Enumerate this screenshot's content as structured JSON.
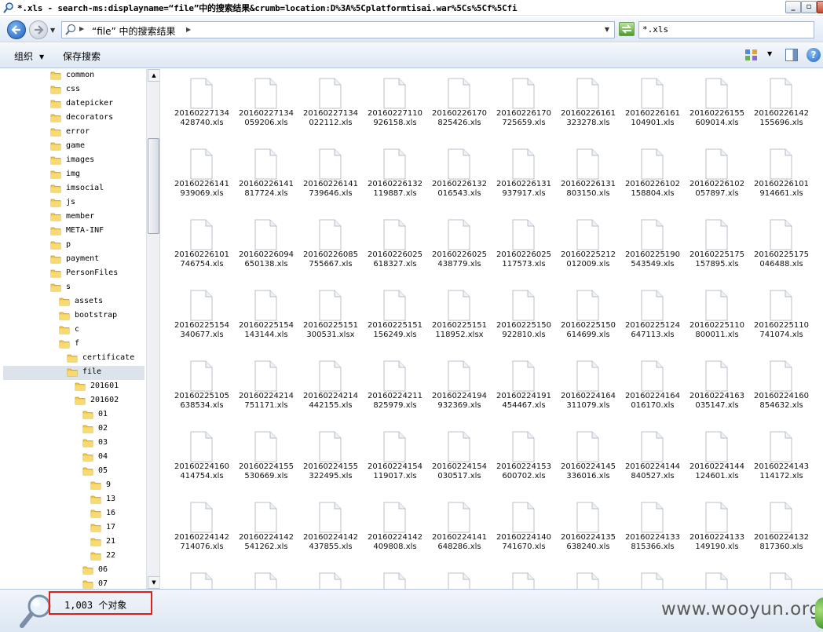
{
  "window": {
    "title": "*.xls - search-ms:displayname=“file”中的搜索结果&crumb=location:D%3A%5Cplatformtisai.war%5Cs%5Cf%5Cfi"
  },
  "address": {
    "breadcrumb": "“file” 中的搜索结果",
    "search_value": "*.xls"
  },
  "toolbar": {
    "organize_label": "组织",
    "save_search_label": "保存搜索",
    "help_label": "?"
  },
  "icons": {
    "back": "back-arrow-icon",
    "forward": "forward-arrow-icon",
    "search": "magnifier-icon",
    "refresh": "refresh-icon",
    "folder": "folder-icon",
    "file": "document-icon",
    "views": "view-grid-icon",
    "preview": "preview-pane-icon"
  },
  "colors": {
    "folder_yellow": "#f1c84b",
    "highlight_red": "#e0201b",
    "selection_gray": "#dde3ea"
  },
  "tree": [
    {
      "label": "common",
      "level": 0
    },
    {
      "label": "css",
      "level": 0
    },
    {
      "label": "datepicker",
      "level": 0
    },
    {
      "label": "decorators",
      "level": 0
    },
    {
      "label": "error",
      "level": 0
    },
    {
      "label": "game",
      "level": 0
    },
    {
      "label": "images",
      "level": 0
    },
    {
      "label": "img",
      "level": 0
    },
    {
      "label": "imsocial",
      "level": 0
    },
    {
      "label": "js",
      "level": 0
    },
    {
      "label": "member",
      "level": 0
    },
    {
      "label": "META-INF",
      "level": 0
    },
    {
      "label": "p",
      "level": 0
    },
    {
      "label": "payment",
      "level": 0
    },
    {
      "label": "PersonFiles",
      "level": 0
    },
    {
      "label": "s",
      "level": 0
    },
    {
      "label": "assets",
      "level": 1
    },
    {
      "label": "bootstrap",
      "level": 1
    },
    {
      "label": "c",
      "level": 1
    },
    {
      "label": "f",
      "level": 1
    },
    {
      "label": "certificate",
      "level": 2
    },
    {
      "label": "file",
      "level": 2,
      "selected": true
    },
    {
      "label": "201601",
      "level": 3
    },
    {
      "label": "201602",
      "level": 3
    },
    {
      "label": "01",
      "level": 4
    },
    {
      "label": "02",
      "level": 4
    },
    {
      "label": "03",
      "level": 4
    },
    {
      "label": "04",
      "level": 4
    },
    {
      "label": "05",
      "level": 4
    },
    {
      "label": "9",
      "level": 5
    },
    {
      "label": "13",
      "level": 5
    },
    {
      "label": "16",
      "level": 5
    },
    {
      "label": "17",
      "level": 5
    },
    {
      "label": "21",
      "level": 5
    },
    {
      "label": "22",
      "level": 5
    },
    {
      "label": "06",
      "level": 4
    },
    {
      "label": "07",
      "level": 4
    }
  ],
  "files": [
    "20160227134428740.xls",
    "20160227134059206.xls",
    "20160227134022112.xls",
    "20160227110926158.xls",
    "20160226170825426.xls",
    "20160226170725659.xls",
    "20160226161323278.xls",
    "20160226161104901.xls",
    "20160226155609014.xls",
    "20160226142155696.xls",
    "20160226141939069.xls",
    "20160226141817724.xls",
    "20160226141739646.xls",
    "20160226132119887.xls",
    "20160226132016543.xls",
    "20160226131937917.xls",
    "20160226131803150.xls",
    "20160226102158804.xls",
    "20160226102057897.xls",
    "20160226101914661.xls",
    "20160226101746754.xls",
    "20160226094650138.xls",
    "20160226085755667.xls",
    "20160226025618327.xls",
    "20160226025438779.xls",
    "20160226025117573.xls",
    "20160225212012009.xls",
    "20160225190543549.xls",
    "20160225175157895.xls",
    "20160225175046488.xls",
    "20160225154340677.xls",
    "20160225154143144.xls",
    "20160225151300531.xlsx",
    "20160225151156249.xls",
    "20160225151118952.xlsx",
    "20160225150922810.xls",
    "20160225150614699.xls",
    "20160225124647113.xls",
    "20160225110800011.xls",
    "20160225110741074.xls",
    "20160225105638534.xls",
    "20160224214751171.xls",
    "20160224214442155.xls",
    "20160224211825979.xls",
    "20160224194932369.xls",
    "20160224191454467.xls",
    "20160224164311079.xls",
    "20160224164016170.xls",
    "20160224163035147.xls",
    "20160224160854632.xls",
    "20160224160414754.xls",
    "20160224155530669.xls",
    "20160224155322495.xls",
    "20160224154119017.xls",
    "20160224154030517.xls",
    "20160224153600702.xls",
    "20160224145336016.xls",
    "20160224144840527.xls",
    "20160224144124601.xls",
    "20160224143114172.xls",
    "20160224142714076.xls",
    "20160224142541262.xls",
    "20160224142437855.xls",
    "20160224142409808.xls",
    "20160224141648286.xls",
    "20160224140741670.xls",
    "20160224135638240.xls",
    "20160224133815366.xls",
    "20160224133149190.xls",
    "20160224132817360.xls",
    "",
    "",
    "",
    "",
    "",
    "",
    "",
    "",
    "",
    ""
  ],
  "status": {
    "item_count": "1,003 个对象",
    "watermark": "www.wooyun.org"
  }
}
